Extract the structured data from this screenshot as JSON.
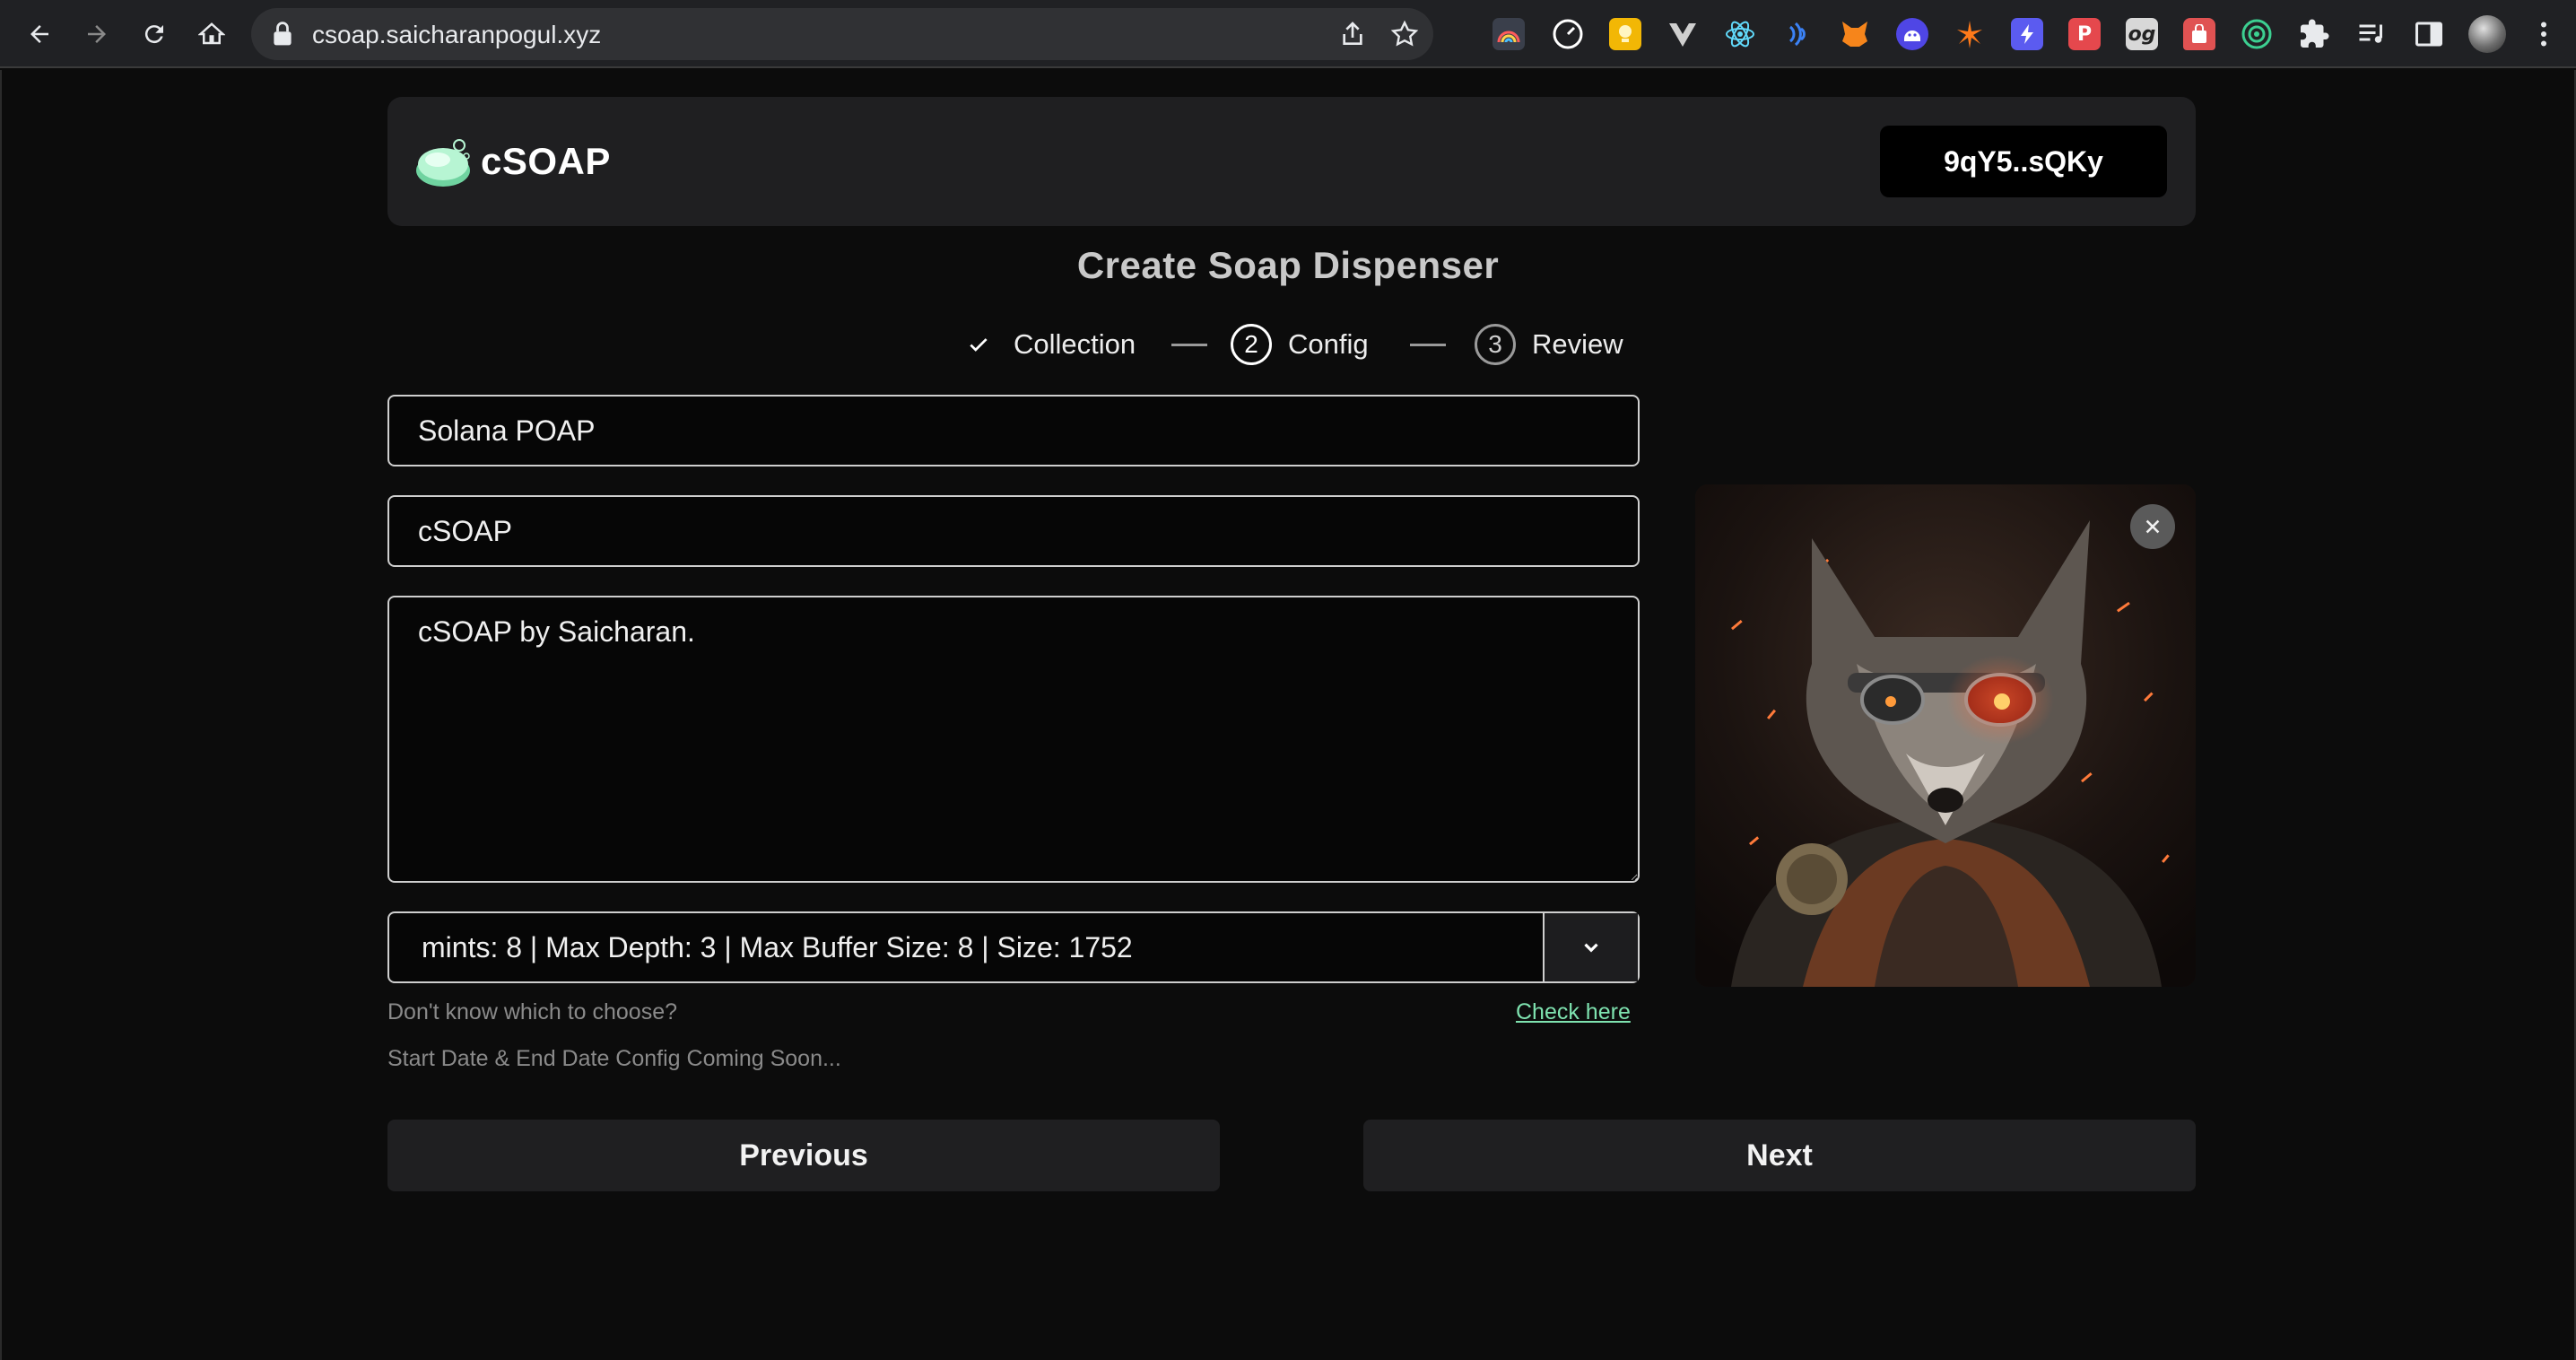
{
  "browser": {
    "url": "csoap.saicharanpogul.xyz",
    "extensions": [
      {
        "name": "rainbow-extension-icon",
        "color": "#8a8fa0"
      },
      {
        "name": "gauge-extension-icon",
        "color": "#ffffff"
      },
      {
        "name": "bulb-extension-icon",
        "color": "#f2b705"
      },
      {
        "name": "vue-extension-icon",
        "color": "#cfcfcf"
      },
      {
        "name": "react-extension-icon",
        "color": "#61dafb"
      },
      {
        "name": "wave-extension-icon",
        "color": "#3b82f6"
      },
      {
        "name": "fox-extension-icon",
        "color": "#f6851b"
      },
      {
        "name": "ghost-extension-icon",
        "color": "#4f46e5"
      },
      {
        "name": "star-extension-icon",
        "color": "#ff7a1a"
      },
      {
        "name": "bolt-extension-icon",
        "color": "#5b5bf0"
      },
      {
        "name": "p-extension-icon",
        "color": "#e5484d"
      },
      {
        "name": "og-extension-icon",
        "color": "#d8d8d8"
      },
      {
        "name": "bag-extension-icon",
        "color": "#e05252"
      },
      {
        "name": "target-extension-icon",
        "color": "#3ccf91"
      }
    ],
    "og_label": "og",
    "p_label": "P"
  },
  "header": {
    "brand": "cSOAP",
    "wallet": "9qY5..sQKy"
  },
  "page": {
    "title": "Create Soap Dispenser",
    "steps": [
      {
        "label": "Collection",
        "state": "done"
      },
      {
        "label": "Config",
        "number": "2",
        "state": "active"
      },
      {
        "label": "Review",
        "number": "3",
        "state": "upcoming"
      }
    ]
  },
  "form": {
    "name": "Solana POAP",
    "symbol": "cSOAP",
    "description": "cSOAP by Saicharan.",
    "tree_config": "mints: 8 | Max Depth: 3 | Max Buffer Size: 8 | Size: 1752",
    "help_text": "Don't know which to choose?",
    "help_link": "Check here",
    "date_note": "Start Date & End Date Config Coming Soon..."
  },
  "actions": {
    "previous": "Previous",
    "next": "Next"
  },
  "colors": {
    "accent": "#7fe3b0",
    "background": "#0c0c0c",
    "card": "#1f1f21"
  }
}
